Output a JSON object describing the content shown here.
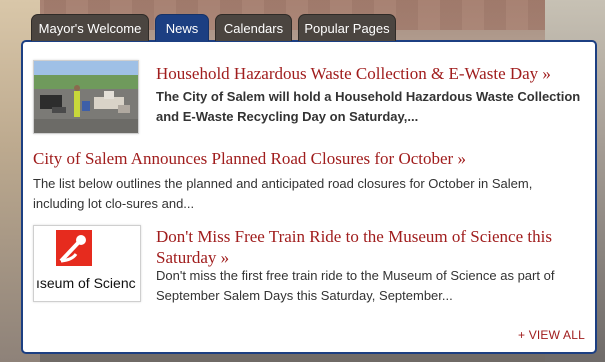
{
  "tabs": [
    {
      "label": "Mayor's Welcome"
    },
    {
      "label": "News"
    },
    {
      "label": "Calendars"
    },
    {
      "label": "Popular Pages"
    }
  ],
  "active_tab": "News",
  "news": [
    {
      "title": "Household Hazardous Waste Collection & E-Waste Day »",
      "summary": "The City of Salem will hold a Household Hazardous Waste Collection and E-Waste Recycling Day on Saturday,..."
    },
    {
      "title": "City of Salem Announces Planned Road Closures for October »",
      "summary": "The list below outlines the planned and anticipated road closures for October in Salem, including lot clo-sures and..."
    },
    {
      "title": "Don't Miss Free Train Ride to the Museum of Science this Saturday »",
      "summary": "Don't miss the first free train ride to the Museum of Science as part of September Salem Days this Saturday, September...",
      "thumb_caption": "ıseum of Scienc"
    }
  ],
  "view_all": "+ VIEW ALL",
  "colors": {
    "accent_blue": "#1c3f82",
    "link_red": "#a01d1d",
    "tab_dark": "#4b4540",
    "text": "#333333"
  }
}
